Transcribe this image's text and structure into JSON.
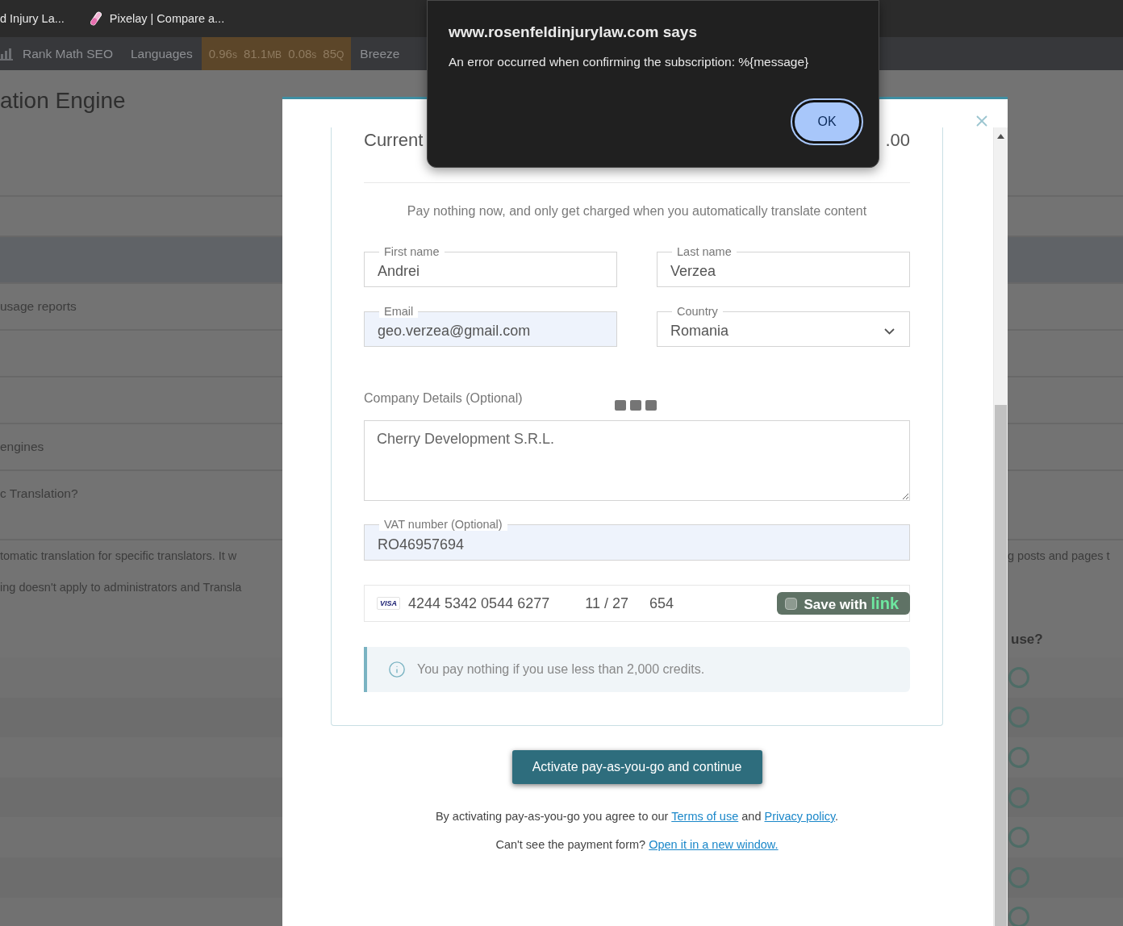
{
  "browser_tabs": [
    {
      "title": "d Injury La...",
      "has_icon": false
    },
    {
      "title": "Pixelay | Compare a...",
      "has_icon": true
    }
  ],
  "admin_bar": {
    "items": [
      {
        "kind": "menu",
        "label": "Rank Math SEO",
        "has_icon": true
      },
      {
        "kind": "menu",
        "label": "Languages",
        "has_icon": false
      },
      {
        "kind": "metrics",
        "values": [
          {
            "value": "0.96",
            "unit": "s"
          },
          {
            "value": "81.1",
            "unit": "MB"
          },
          {
            "value": "0.08",
            "unit": "s"
          },
          {
            "value": "85",
            "unit": "Q"
          }
        ]
      },
      {
        "kind": "menu",
        "label": "Breeze",
        "has_icon": false
      }
    ]
  },
  "page": {
    "title": "ation Engine",
    "rows": [
      {
        "highlighted": false
      },
      {
        "highlighted": true
      },
      {
        "highlighted": false,
        "label": "usage reports"
      },
      {
        "highlighted": false
      },
      {
        "highlighted": false
      },
      {
        "highlighted": false,
        "label": "engines"
      },
      {
        "highlighted": false,
        "label": "c Translation?"
      }
    ],
    "paragraph_left": [
      "tomatic translation for specific translators. It w",
      "ing doesn't apply to administrators and Transla"
    ],
    "paragraph_right": [
      "g posts and pages t"
    ],
    "right_heading": "use?",
    "toggles": [
      {
        "on": false
      },
      {
        "on": false
      },
      {
        "on": false
      },
      {
        "on": false
      },
      {
        "on": false
      },
      {
        "on": false
      },
      {
        "on": false
      }
    ]
  },
  "modal": {
    "balance_label": "Current",
    "balance_value": ".00",
    "subtitle": "Pay nothing now, and only get charged when you automatically translate content",
    "fields": [
      {
        "kind": "text",
        "label": "First name",
        "value": "Andrei",
        "autofilled": false
      },
      {
        "kind": "text",
        "label": "Last name",
        "value": "Verzea",
        "autofilled": false
      },
      {
        "kind": "text",
        "label": "Email",
        "value": "geo.verzea@gmail.com",
        "autofilled": true
      },
      {
        "kind": "select",
        "label": "Country",
        "value": "Romania",
        "autofilled": false
      }
    ],
    "company": {
      "label": "Company Details (Optional)",
      "value": "Cherry Development S.R.L.",
      "loading": true
    },
    "vat": {
      "label": "VAT number (Optional)",
      "value": "RO46957694",
      "autofilled": true
    },
    "card": {
      "brand": "VISA",
      "number": "4244 5342 0544 6277",
      "expiry": "11 / 27",
      "cvc": "654",
      "save_label": "Save with",
      "save_brand": "link",
      "save_checked": false
    },
    "info": "You pay nothing if you use less than 2,000 credits.",
    "submit_button": "Activate pay-as-you-go and continue",
    "terms": {
      "before": "By activating pay-as-you-go you agree to our",
      "link_1": "Terms of use",
      "middle": "and",
      "link_2": "Privacy policy",
      "after": "."
    },
    "help": {
      "before": "Can't see the payment form?",
      "link": "Open it in a new window."
    }
  },
  "alert": {
    "title": "www.rosenfeldinjurylaw.com says",
    "message": "An error occurred when confirming the subscription: %{message}",
    "button": "OK"
  }
}
